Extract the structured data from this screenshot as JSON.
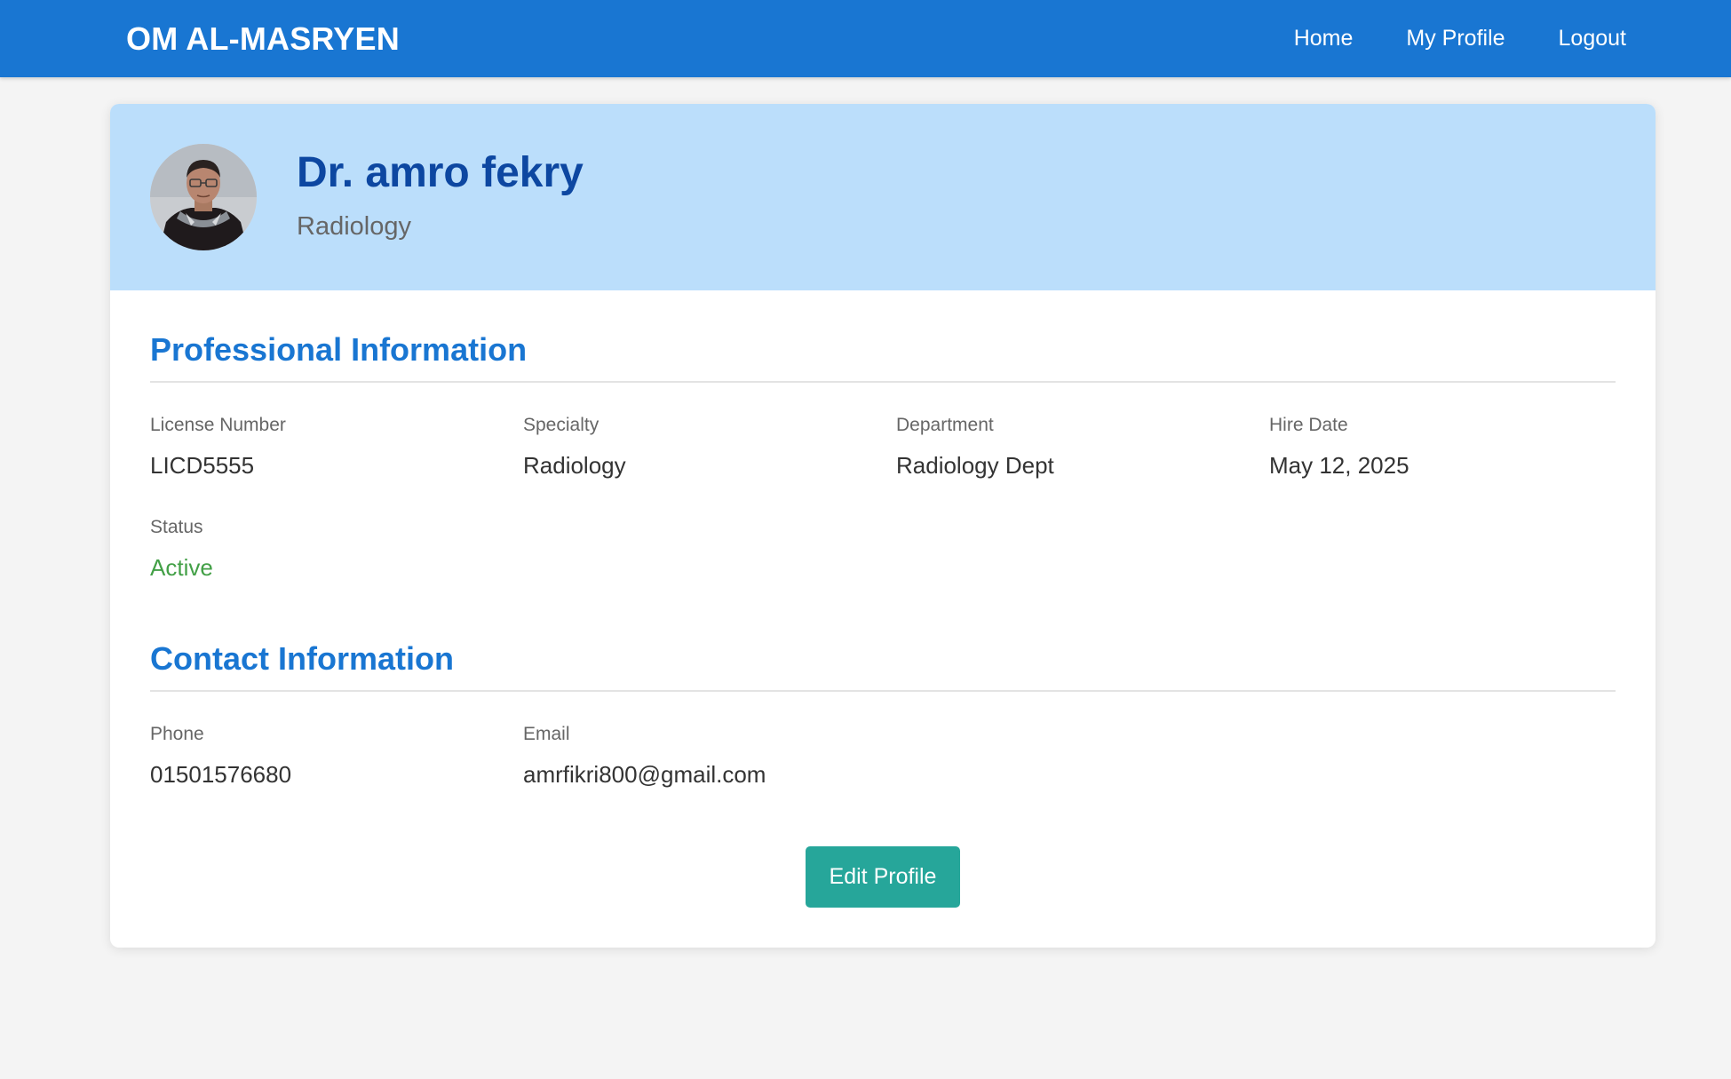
{
  "navbar": {
    "brand": "OM AL-MASRYEN",
    "links": [
      {
        "label": "Home"
      },
      {
        "label": "My Profile"
      },
      {
        "label": "Logout"
      }
    ]
  },
  "profile": {
    "name": "Dr. amro fekry",
    "specialty": "Radiology"
  },
  "professional": {
    "title": "Professional Information",
    "license": {
      "label": "License Number",
      "value": "LICD5555"
    },
    "specialty": {
      "label": "Specialty",
      "value": "Radiology"
    },
    "department": {
      "label": "Department",
      "value": "Radiology Dept"
    },
    "hire_date": {
      "label": "Hire Date",
      "value": "May 12, 2025"
    },
    "status": {
      "label": "Status",
      "value": "Active"
    }
  },
  "contact": {
    "title": "Contact Information",
    "phone": {
      "label": "Phone",
      "value": "01501576680"
    },
    "email": {
      "label": "Email",
      "value": "amrfikri800@gmail.com"
    }
  },
  "actions": {
    "edit_label": "Edit Profile"
  },
  "colors": {
    "navbar": "#1976d2",
    "header_bg": "#bbdefb",
    "name_color": "#0d47a1",
    "section_title": "#1976d2",
    "status_active": "#43a047",
    "button": "#26a69a"
  }
}
